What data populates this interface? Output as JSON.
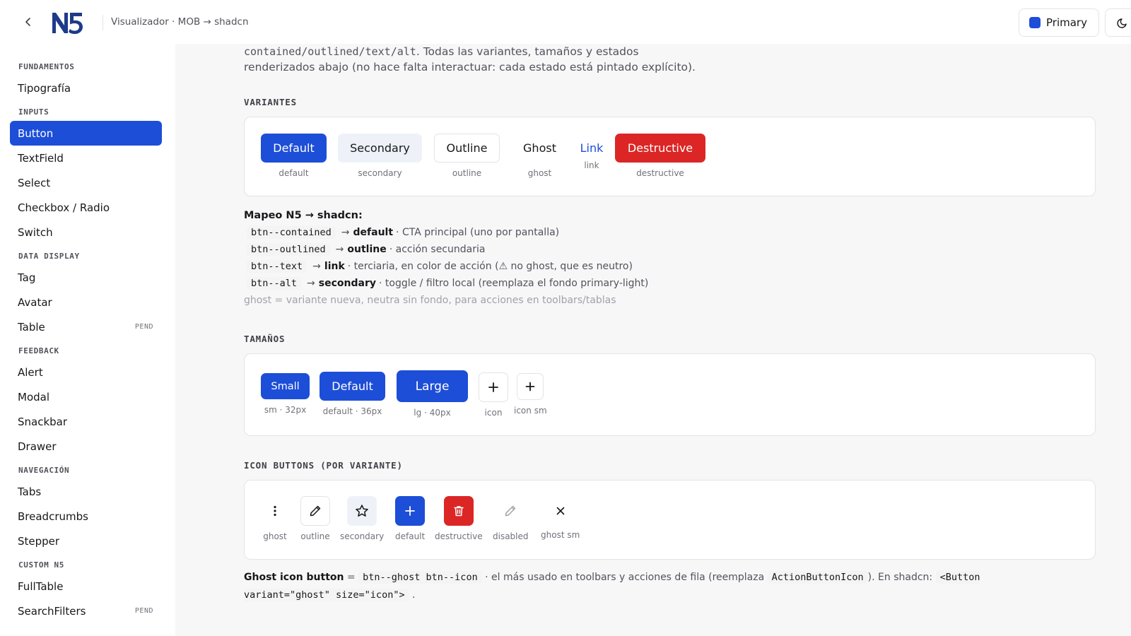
{
  "header": {
    "breadcrumb": "Visualizador · MOB → shadcn",
    "primary_label": "Primary",
    "primary_color": "#1d4ed8"
  },
  "sidebar": {
    "sections": [
      {
        "title": "FUNDAMENTOS",
        "items": [
          {
            "label": "Tipografía"
          }
        ]
      },
      {
        "title": "INPUTS",
        "items": [
          {
            "label": "Button",
            "active": true
          },
          {
            "label": "TextField"
          },
          {
            "label": "Select"
          },
          {
            "label": "Checkbox / Radio"
          },
          {
            "label": "Switch"
          }
        ]
      },
      {
        "title": "DATA DISPLAY",
        "items": [
          {
            "label": "Tag"
          },
          {
            "label": "Avatar"
          },
          {
            "label": "Table",
            "badge": "PEND"
          }
        ]
      },
      {
        "title": "FEEDBACK",
        "items": [
          {
            "label": "Alert"
          },
          {
            "label": "Modal"
          },
          {
            "label": "Snackbar"
          },
          {
            "label": "Drawer"
          }
        ]
      },
      {
        "title": "NAVEGACIÓN",
        "items": [
          {
            "label": "Tabs"
          },
          {
            "label": "Breadcrumbs"
          },
          {
            "label": "Stepper"
          }
        ]
      },
      {
        "title": "CUSTOM N5",
        "items": [
          {
            "label": "FullTable"
          },
          {
            "label": "SearchFilters",
            "badge": "PEND"
          }
        ]
      }
    ]
  },
  "intro": {
    "code": "contained/outlined/text/alt",
    "text1": ". Todas las variantes, tamaños y estados",
    "text2": "renderizados abajo (no hace falta interactuar: cada estado está pintado explícito)."
  },
  "variants": {
    "heading": "VARIANTES",
    "items": [
      {
        "label": "Default",
        "caption": "default"
      },
      {
        "label": "Secondary",
        "caption": "secondary"
      },
      {
        "label": "Outline",
        "caption": "outline"
      },
      {
        "label": "Ghost",
        "caption": "ghost"
      },
      {
        "label": "Link",
        "caption": "link"
      },
      {
        "label": "Destructive",
        "caption": "destructive"
      }
    ]
  },
  "mapping": {
    "title": "Mapeo N5 → shadcn:",
    "arrow": "→",
    "rows": [
      {
        "code": "btn--contained",
        "target": "default",
        "desc": "· CTA principal (uno por pantalla)"
      },
      {
        "code": "btn--outlined",
        "target": "outline",
        "desc": "· acción secundaria"
      },
      {
        "code": "btn--text",
        "target": "link",
        "desc": "· terciaria, en color de acción (⚠ no ghost, que es neutro)"
      },
      {
        "code": "btn--alt",
        "target": "secondary",
        "desc": "· toggle / filtro local (reemplaza el fondo primary-light)"
      }
    ],
    "note": "ghost = variante nueva, neutra sin fondo, para acciones en toolbars/tablas"
  },
  "sizes": {
    "heading": "TAMAÑOS",
    "items": [
      {
        "label": "Small",
        "caption": "sm · 32px"
      },
      {
        "label": "Default",
        "caption": "default · 36px"
      },
      {
        "label": "Large",
        "caption": "lg · 40px"
      },
      {
        "label": "",
        "caption": "icon",
        "icon": "plus-icon"
      },
      {
        "label": "",
        "caption": "icon sm",
        "icon": "plus-icon"
      }
    ]
  },
  "icon_buttons": {
    "heading": "ICON BUTTONS (POR VARIANTE)",
    "items": [
      {
        "icon": "more-vertical-icon",
        "caption": "ghost"
      },
      {
        "icon": "pencil-icon",
        "caption": "outline"
      },
      {
        "icon": "star-icon",
        "caption": "secondary"
      },
      {
        "icon": "plus-icon",
        "caption": "default"
      },
      {
        "icon": "trash-icon",
        "caption": "destructive"
      },
      {
        "icon": "pencil-icon",
        "caption": "disabled"
      },
      {
        "icon": "close-icon",
        "caption": "ghost sm"
      }
    ]
  },
  "footer": {
    "bold": "Ghost icon button",
    "eq": "=",
    "code1": "btn--ghost btn--icon",
    "text1": "· el más usado en toolbars y acciones de fila (reemplaza",
    "code2": "ActionButtonIcon",
    "text2": "). En shadcn:",
    "code3": "<Button variant=\"ghost\" size=\"icon\">",
    "end": "."
  }
}
